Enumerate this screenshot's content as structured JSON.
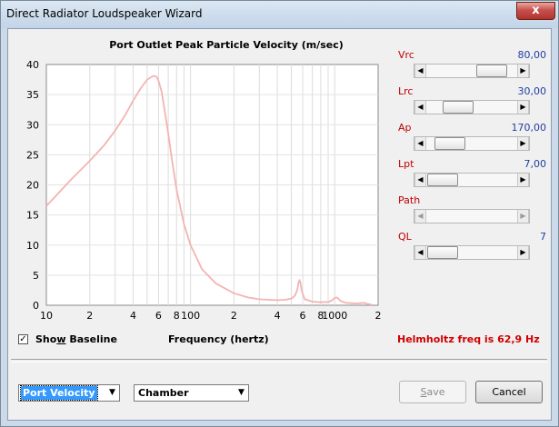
{
  "window": {
    "title": "Direct Radiator Loudspeaker Wizard",
    "close_glyph": "x"
  },
  "chart_data": {
    "type": "line",
    "title": "Port Outlet Peak Particle Velocity (m/sec)",
    "xlabel": "Frequency (hertz)",
    "ylabel": "",
    "xscale": "log",
    "xlim": [
      10,
      2000
    ],
    "ylim": [
      0,
      40
    ],
    "grid": true,
    "y_ticks": [
      "0",
      "5",
      "10",
      "15",
      "20",
      "25",
      "30",
      "35",
      "40"
    ],
    "x_ticks": [
      {
        "value": 10,
        "label": "10"
      },
      {
        "value": 20,
        "label": "2"
      },
      {
        "value": 40,
        "label": "4"
      },
      {
        "value": 60,
        "label": "6"
      },
      {
        "value": 80,
        "label": "8"
      },
      {
        "value": 100,
        "label": "100"
      },
      {
        "value": 200,
        "label": "2"
      },
      {
        "value": 400,
        "label": "4"
      },
      {
        "value": 600,
        "label": "6"
      },
      {
        "value": 800,
        "label": "8"
      },
      {
        "value": 1000,
        "label": "1000"
      },
      {
        "value": 2000,
        "label": "2"
      }
    ],
    "series": [
      {
        "color": "#f4b3b3",
        "x": [
          10,
          12,
          15,
          20,
          25,
          30,
          35,
          40,
          45,
          50,
          55,
          58,
          60,
          63,
          66,
          70,
          75,
          80,
          90,
          100,
          120,
          150,
          200,
          250,
          300,
          350,
          400,
          450,
          500,
          530,
          550,
          560,
          570,
          580,
          590,
          620,
          700,
          800,
          900,
          950,
          1000,
          1030,
          1060,
          1100,
          1200,
          1300,
          1400,
          1500,
          1600,
          1700,
          1800
        ],
        "y": [
          16.5,
          18.5,
          21,
          24,
          26.5,
          29,
          31.5,
          34,
          36,
          37.5,
          38.1,
          38,
          37.3,
          35.5,
          32.5,
          28.5,
          23.5,
          19.2,
          13.5,
          10,
          6,
          3.6,
          2,
          1.3,
          1,
          0.9,
          0.85,
          0.9,
          1.1,
          1.6,
          2.6,
          3.6,
          4.2,
          3.6,
          2.4,
          1,
          0.6,
          0.5,
          0.55,
          0.75,
          1.2,
          1.3,
          1.1,
          0.7,
          0.4,
          0.35,
          0.3,
          0.35,
          0.4,
          0.2,
          0.1
        ]
      }
    ]
  },
  "controls": [
    {
      "label": "Vrc",
      "value": "80,00",
      "fraction": 0.84,
      "enabled": true
    },
    {
      "label": "Lrc",
      "value": "30,00",
      "fraction": 0.28,
      "enabled": true
    },
    {
      "label": "Ap",
      "value": "170,00",
      "fraction": 0.13,
      "enabled": true
    },
    {
      "label": "Lpt",
      "value": "7,00",
      "fraction": 0.02,
      "enabled": true
    },
    {
      "label": "Path",
      "value": "",
      "fraction": null,
      "enabled": false
    },
    {
      "label": "QL",
      "value": "7",
      "fraction": 0.02,
      "enabled": true
    }
  ],
  "show_baseline": {
    "label_pre": "Sho",
    "label_underline": "w",
    "label_post": " Baseline",
    "checked_glyph": "✓"
  },
  "helmholtz": "Helmholtz freq is 62,9 Hz",
  "combo_view": {
    "value": "Port Velocity",
    "arrow": "▼"
  },
  "combo_section": {
    "value": "Chamber",
    "arrow": "▼"
  },
  "buttons": {
    "save": {
      "pre": "",
      "underline": "S",
      "post": "ave"
    },
    "cancel": "Cancel"
  },
  "icons": {
    "arrow_left": "◀",
    "arrow_right": "▶"
  }
}
